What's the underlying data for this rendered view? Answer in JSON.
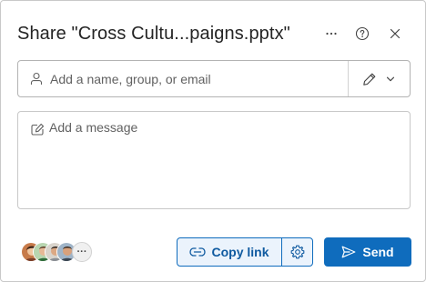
{
  "dialog": {
    "title": "Share \"Cross Cultu...paigns.pptx\"",
    "more_options_icon": "ellipsis-icon",
    "help_icon": "question-circle-icon",
    "close_icon": "close-icon"
  },
  "recipients": {
    "placeholder": "Add a name, group, or email",
    "value": "",
    "icon": "person-icon",
    "permission_icon": "pencil-icon",
    "permission_dropdown_icon": "chevron-down-icon"
  },
  "message": {
    "placeholder": "Add a message",
    "value": "",
    "icon": "message-edit-icon"
  },
  "shared_with": {
    "avatars": [
      "avatar-1",
      "avatar-2",
      "avatar-3",
      "avatar-4"
    ],
    "more_label": "···"
  },
  "footer": {
    "copy_link_label": "Copy link",
    "copy_link_icon": "link-icon",
    "settings_icon": "gear-icon",
    "send_label": "Send",
    "send_icon": "send-icon"
  },
  "colors": {
    "accent": "#0f6cbd",
    "accent_light": "#ebf3fc",
    "text": "#242424",
    "placeholder": "#616161",
    "border": "#c8c8c8"
  }
}
